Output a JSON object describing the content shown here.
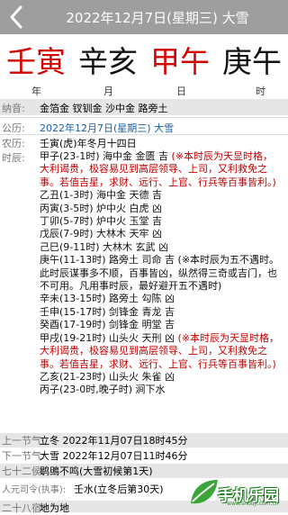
{
  "header": {
    "title": "2022年12月7日(星期三)  大雪",
    "back_icon": "chevron-left-icon"
  },
  "pillars": [
    {
      "text": "壬寅",
      "color": "#d40000"
    },
    {
      "text": "辛亥",
      "color": "#111111"
    },
    {
      "text": "甲午",
      "color": "#d40000"
    },
    {
      "text": "庚午",
      "color": "#111111"
    }
  ],
  "pillar_labels": [
    "年",
    "月",
    "日",
    "时"
  ],
  "nayin": {
    "label": "纳音:",
    "value": "金箔金    钗钏金    沙中金    路旁土"
  },
  "gongli": {
    "label": "公历:",
    "value": "2022年12月7日(星期三)  大雪"
  },
  "nongli": {
    "label": "农历:",
    "value": "壬寅(虎)年冬月十四日"
  },
  "shichen": {
    "label": "时辰:",
    "items": [
      {
        "main": "甲子(23-1时) 海中金 金匮 吉 ",
        "note": "(※本时辰为天显时格，大利谒贵，极容易见到高层领导、上司，又利救免之事。若值吉星，求财、远行、上官、行兵等百事皆利。)"
      },
      {
        "main": "乙丑(1-3时) 海中金 天德 吉",
        "note": ""
      },
      {
        "main": "丙寅(3-5时) 炉中火 白虎 凶",
        "note": ""
      },
      {
        "main": "丁卯(5-7时) 炉中火 玉堂 吉",
        "note": ""
      },
      {
        "main": "戊辰(7-9时) 大林木 天牢 凶",
        "note": ""
      },
      {
        "main": "己巳(9-11时) 大林木 玄武 凶",
        "note": ""
      },
      {
        "main": "庚午(11-13时) 路旁土 司命 吉 (※本时辰为五不遇时。此时辰谋事多不顺，百事皆凶，纵然得三奇或吉门，也不可用。凡用事时辰，最好避开五不遇时)",
        "note": ""
      },
      {
        "main": "辛未(13-15时) 路旁土 勾陈 凶",
        "note": ""
      },
      {
        "main": "壬申(15-17时) 剑锋金 青龙 吉",
        "note": ""
      },
      {
        "main": "癸酉(17-19时) 剑锋金 明堂 吉",
        "note": ""
      },
      {
        "main": "甲戌(19-21时) 山头火 天刑 凶 ",
        "note": "(※本时辰为天显时格，大利谒贵，极容易见到高层领导、上司，又利救免之事。若值吉星，求财、远行、上官、行兵等百事皆利。)"
      },
      {
        "main": "乙亥(21-23时) 山头火 朱雀 凶",
        "note": ""
      },
      {
        "main": "丙子(23-0时,晚子时) 涧下水",
        "note": ""
      }
    ]
  },
  "prev_jieqi": {
    "label": "上一节气:",
    "value": "立冬  2022年11月07日18时45分"
  },
  "next_jieqi": {
    "label": "下一节气:",
    "value": "大雪  2022年12月07日11时46分"
  },
  "hou": {
    "label": "七十二侯:",
    "value": "鹖鴠不鸣(大雪初候第1天)"
  },
  "siling": {
    "label": "人元司令(执事):",
    "value": "壬水(立冬后第30天)"
  },
  "bottom": {
    "label": "二十八宿:",
    "value": "地为地"
  },
  "watermark": {
    "text": "手机乐园",
    "sub": "www.shouji.com.cn",
    "accent": "#2e9b2e"
  }
}
